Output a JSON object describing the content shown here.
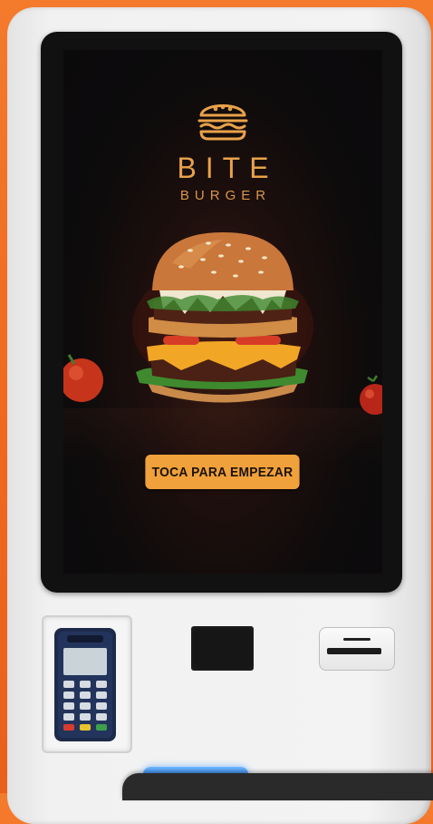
{
  "brand": {
    "name": "BITE",
    "tagline": "BURGER",
    "accent_color": "#f0a13b",
    "logo_icon": "burger-icon"
  },
  "screen": {
    "cta_label": "TOCA PARA EMPEZAR",
    "hero_image": "burger-photo"
  },
  "hardware": {
    "card_reader": "card-terminal",
    "scanner": "qr-scanner",
    "printer": "receipt-printer",
    "base_light": "status-light"
  }
}
